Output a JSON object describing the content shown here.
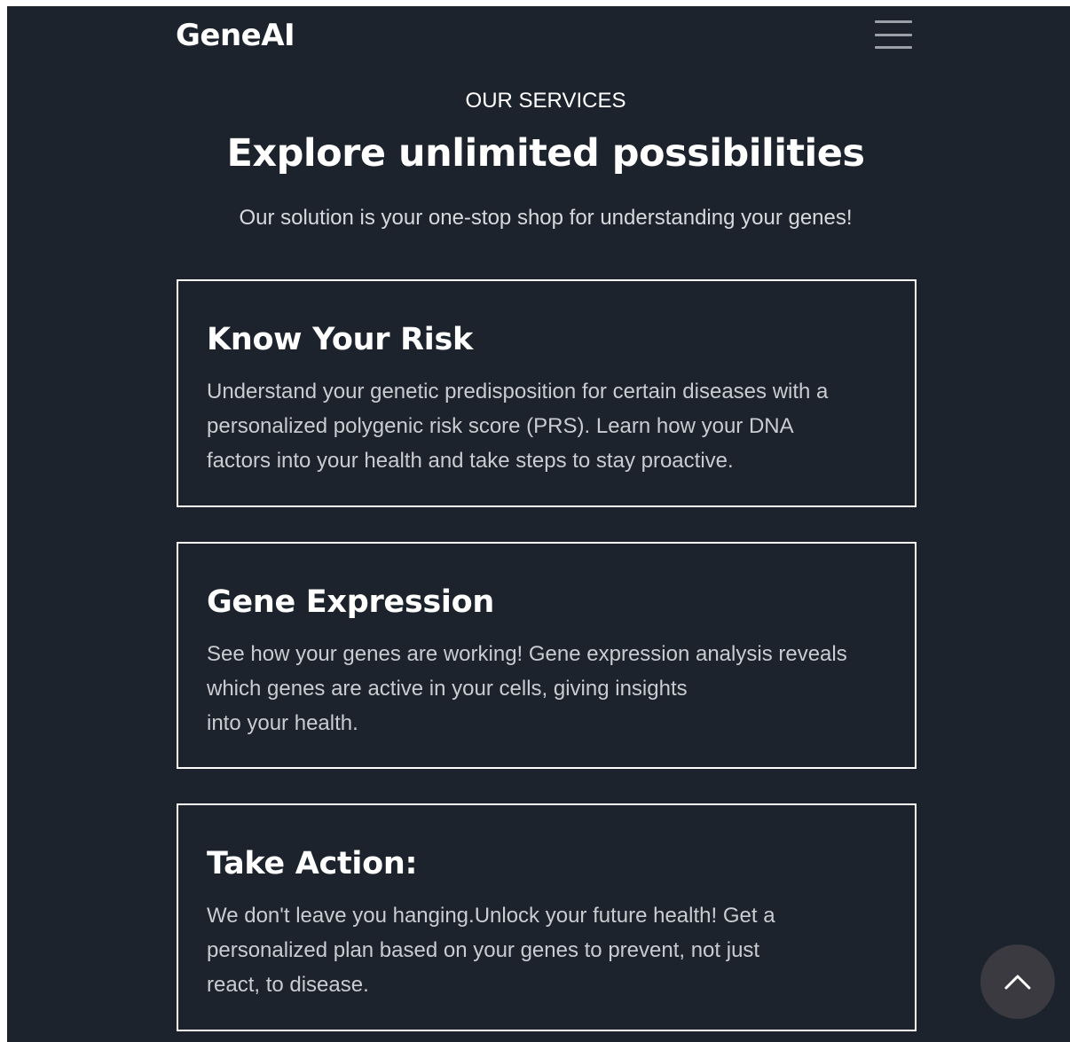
{
  "header": {
    "brand": "GeneAI",
    "menu_icon": "hamburger-menu-icon"
  },
  "services": {
    "kicker": "OUR SERVICES",
    "headline": "Explore unlimited possibilities",
    "subhead": "Our solution is your one-stop shop for understanding your genes!",
    "cards": [
      {
        "title": "Know Your Risk",
        "lines": [
          "Understand your genetic predisposition for certain diseases with a",
          "personalized polygenic risk score (PRS). Learn how your DNA",
          "factors into your health and take steps to stay proactive."
        ]
      },
      {
        "title": "Gene Expression",
        "lines": [
          "See how your genes are working! Gene expression analysis reveals",
          "which genes are active in your cells, giving insights",
          "into your health."
        ]
      },
      {
        "title": "Take Action:",
        "lines": [
          "We don't leave you hanging.Unlock your future health! Get a",
          "personalized plan based on your genes to prevent, not just",
          "react, to disease."
        ]
      }
    ]
  },
  "scroll_top": {
    "icon": "chevron-up-icon"
  },
  "colors": {
    "background": "#1c232c",
    "text": "#ffffff",
    "muted_text": "#c9ccd1",
    "card_border": "#ffffff",
    "scroll_button": "#3a3a40"
  }
}
